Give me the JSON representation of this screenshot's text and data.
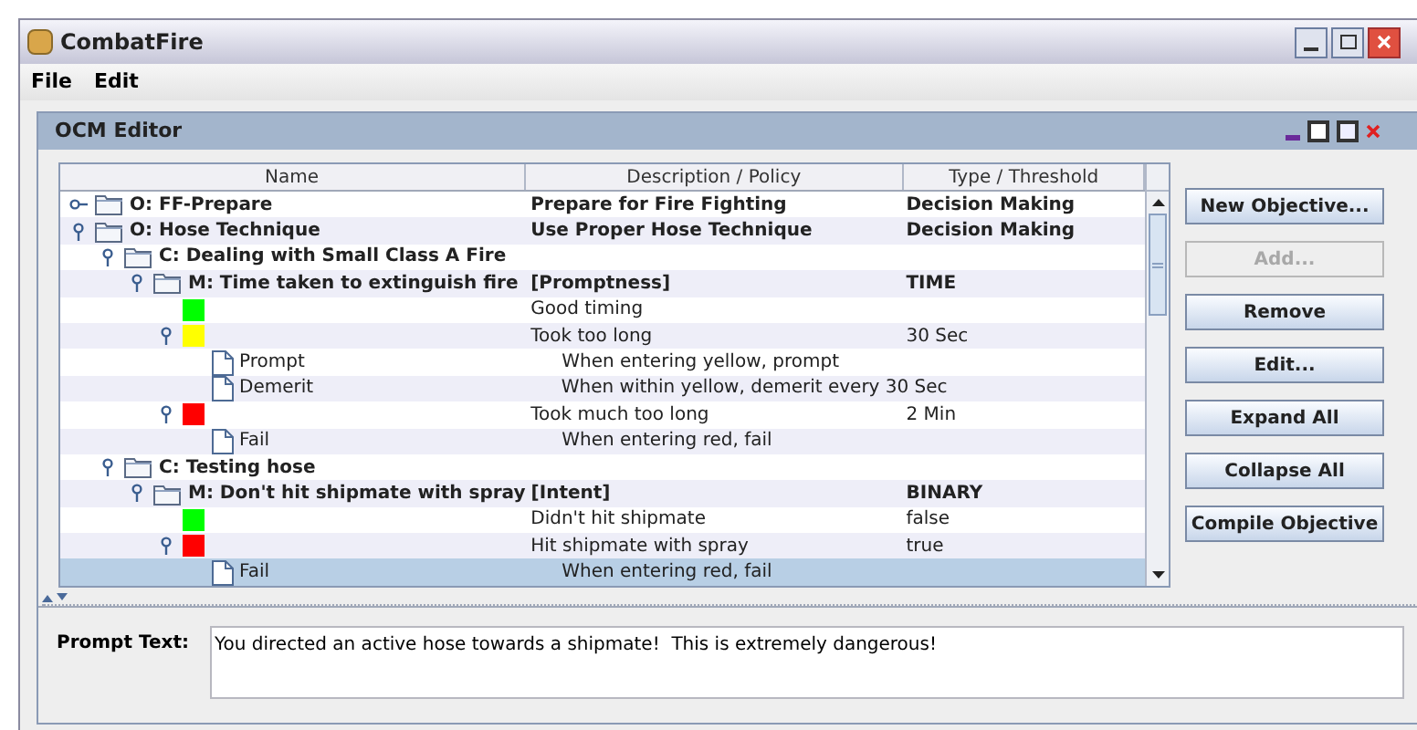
{
  "window": {
    "title": "CombatFire"
  },
  "menu": [
    {
      "label": "File"
    },
    {
      "label": "Edit"
    }
  ],
  "frame": {
    "title": "OCM Editor"
  },
  "table": {
    "columns": [
      "Name",
      "Description / Policy",
      "Type / Threshold"
    ],
    "rows": [
      {
        "kind": "folder",
        "name": "O: FF-Prepare",
        "description": "Prepare for Fire Fighting",
        "threshold": "Decision Making",
        "expanded": false,
        "selected": false
      },
      {
        "kind": "folder",
        "name": "O: Hose Technique",
        "description": "Use Proper Hose Technique",
        "threshold": "Decision Making",
        "expanded": true,
        "selected": false,
        "children": [
          {
            "kind": "folder",
            "name": "C: Dealing with Small Class A Fire",
            "expanded": true,
            "selected": false,
            "children": [
              {
                "kind": "folder",
                "name": "M: Time taken to extinguish fire",
                "description": "[Promptness]",
                "threshold": "TIME",
                "expanded": true,
                "selected": false,
                "children": [
                  {
                    "kind": "level",
                    "color": "#00ff00",
                    "description": "Good timing",
                    "selected": false
                  },
                  {
                    "kind": "level",
                    "color": "#ffff00",
                    "description": "Took too long",
                    "threshold": "30 Sec",
                    "expanded": true,
                    "selected": false,
                    "children": [
                      {
                        "kind": "doc",
                        "name": "Prompt",
                        "description": "When entering yellow, prompt",
                        "selected": false
                      },
                      {
                        "kind": "doc",
                        "name": "Demerit",
                        "description": "When within yellow, demerit every 30 Sec",
                        "selected": false
                      }
                    ]
                  },
                  {
                    "kind": "level",
                    "color": "#ff0000",
                    "description": "Took much too long",
                    "threshold": "2 Min",
                    "expanded": true,
                    "selected": false,
                    "children": [
                      {
                        "kind": "doc",
                        "name": "Fail",
                        "description": "When entering red, fail",
                        "selected": false
                      }
                    ]
                  }
                ]
              }
            ]
          },
          {
            "kind": "folder",
            "name": "C: Testing hose",
            "expanded": true,
            "selected": false,
            "children": [
              {
                "kind": "folder",
                "name": "M: Don't hit shipmate with spray",
                "description": "[Intent]",
                "threshold": "BINARY",
                "expanded": true,
                "selected": false,
                "children": [
                  {
                    "kind": "level",
                    "color": "#00ff00",
                    "description": "Didn't hit shipmate",
                    "threshold": "false",
                    "selected": false
                  },
                  {
                    "kind": "level",
                    "color": "#ff0000",
                    "description": "Hit shipmate with spray",
                    "threshold": "true",
                    "expanded": true,
                    "selected": false,
                    "children": [
                      {
                        "kind": "doc",
                        "name": "Fail",
                        "description": "When entering red, fail",
                        "selected": true
                      }
                    ]
                  }
                ]
              }
            ]
          }
        ]
      }
    ]
  },
  "buttons": [
    {
      "label": "New Objective...",
      "disabled": false
    },
    {
      "label": "Add...",
      "disabled": true
    },
    {
      "label": "Remove",
      "disabled": false
    },
    {
      "label": "Edit...",
      "disabled": false
    },
    {
      "label": "Expand All",
      "disabled": false
    },
    {
      "label": "Collapse All",
      "disabled": false
    },
    {
      "label": "Compile Objective",
      "disabled": false
    }
  ],
  "prompt": {
    "label": "Prompt Text:",
    "value": "You directed an active hose towards a shipmate!  This is extremely dangerous!"
  }
}
